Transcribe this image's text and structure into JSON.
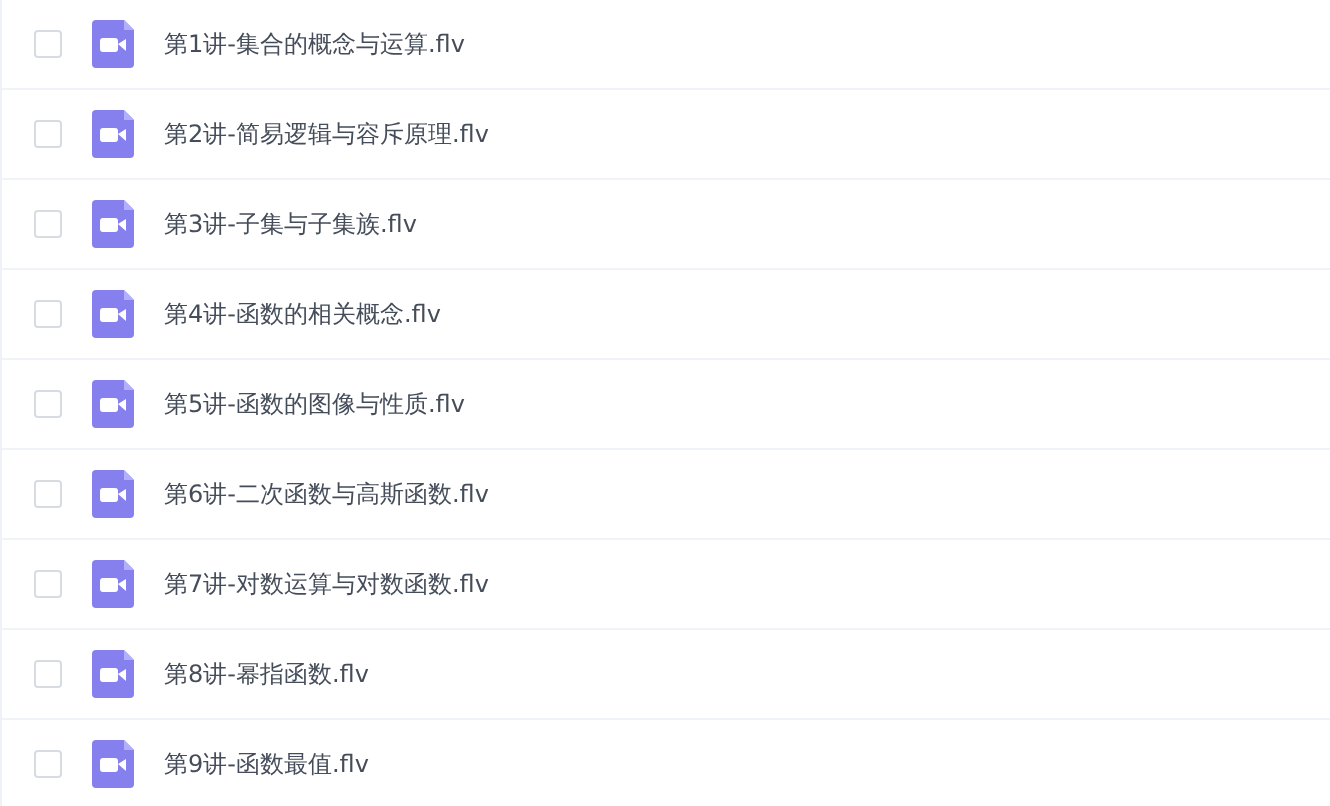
{
  "files": [
    {
      "name": "第1讲-集合的概念与运算.flv",
      "checked": false
    },
    {
      "name": "第2讲-简易逻辑与容斥原理.flv",
      "checked": false
    },
    {
      "name": "第3讲-子集与子集族.flv",
      "checked": false
    },
    {
      "name": "第4讲-函数的相关概念.flv",
      "checked": false
    },
    {
      "name": "第5讲-函数的图像与性质.flv",
      "checked": false
    },
    {
      "name": "第6讲-二次函数与高斯函数.flv",
      "checked": false
    },
    {
      "name": "第7讲-对数运算与对数函数.flv",
      "checked": false
    },
    {
      "name": "第8讲-幂指函数.flv",
      "checked": false
    },
    {
      "name": "第9讲-函数最值.flv",
      "checked": false
    }
  ]
}
